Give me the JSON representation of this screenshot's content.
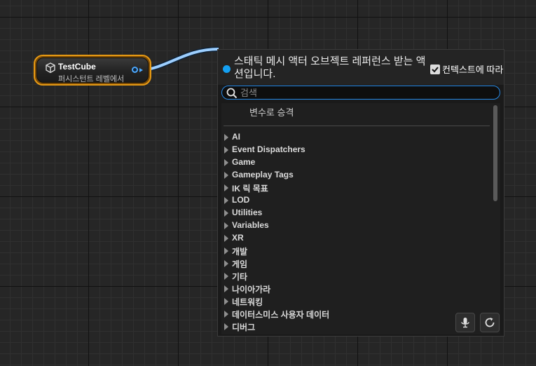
{
  "node": {
    "title": "TestCube",
    "subtitle": "퍼시스턴트 레벨에서",
    "icon": "cube-icon",
    "border_color": "#e79a14",
    "pin_color": "#4ca9ff"
  },
  "menu": {
    "title": "스태틱 메시 액터 오브젝트 레퍼런스 받는 액션입니다.",
    "context_label": "컨텍스트에 따라",
    "context_checked": true,
    "search_placeholder": "검색",
    "search_value": "",
    "promote_label": "변수로 승격",
    "accent_color": "#14a0f2",
    "categories": [
      "AI",
      "Event Dispatchers",
      "Game",
      "Gameplay Tags",
      "IK 릭 목표",
      "LOD",
      "Utilities",
      "Variables",
      "XR",
      "개발",
      "게임",
      "기타",
      "나이아가라",
      "네트워킹",
      "데이터스미스 사용자 데이터",
      "디버그"
    ]
  }
}
